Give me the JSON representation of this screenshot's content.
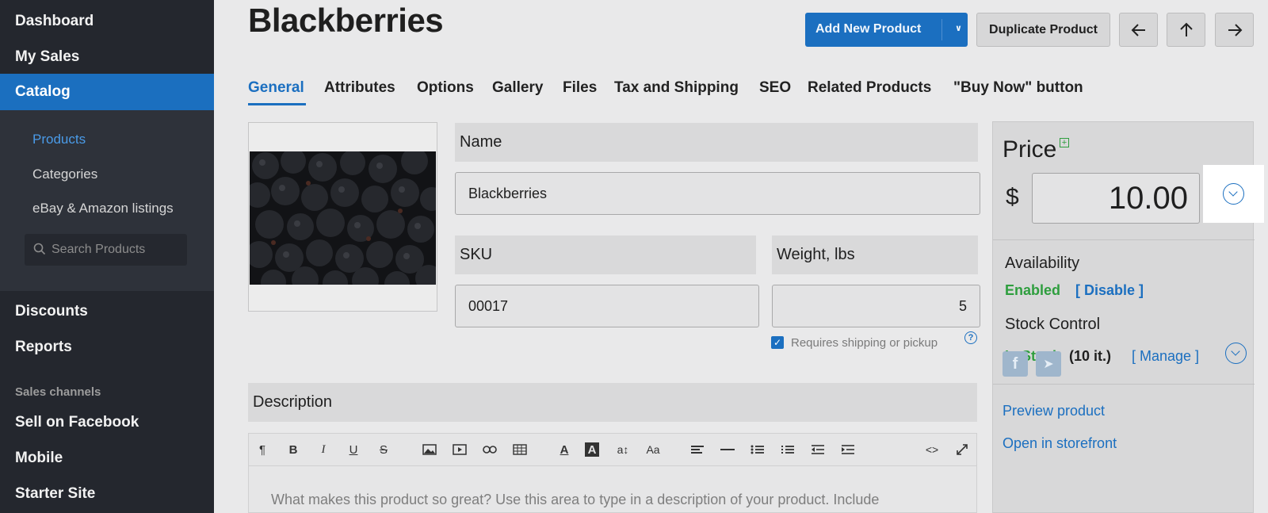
{
  "sidebar": {
    "items_top": [
      "Dashboard",
      "My Sales"
    ],
    "active": "Catalog",
    "submenu": [
      "Products",
      "Categories",
      "eBay & Amazon listings"
    ],
    "search_placeholder": "Search Products",
    "items_bottom": [
      "Discounts",
      "Reports"
    ],
    "section_label": "Sales channels",
    "channels": [
      "Sell on Facebook",
      "Mobile",
      "Starter Site"
    ]
  },
  "header": {
    "title": "Blackberries",
    "add_new": "Add New Product",
    "duplicate": "Duplicate Product"
  },
  "tabs": [
    "General",
    "Attributes",
    "Options",
    "Gallery",
    "Files",
    "Tax and Shipping",
    "SEO",
    "Related Products",
    "\"Buy Now\" button"
  ],
  "form": {
    "name_label": "Name",
    "name_value": "Blackberries",
    "sku_label": "SKU",
    "sku_value": "00017",
    "weight_label": "Weight, lbs",
    "weight_value": "5",
    "requires_shipping": "Requires shipping or pickup",
    "description_label": "Description",
    "description_placeholder": "What makes this product so great? Use this area to type in a description of your product. Include"
  },
  "panel": {
    "price_title": "Price",
    "currency": "$",
    "price_value": "10.00",
    "availability_label": "Availability",
    "availability_status": "Enabled",
    "disable_link": "[ Disable ]",
    "stock_label": "Stock Control",
    "stock_status": "In Stock",
    "stock_count": "(10 it.)",
    "manage_link": "[ Manage ]",
    "preview_link": "Preview product",
    "storefront_link": "Open in storefront"
  },
  "colors": {
    "accent": "#1b6fc0",
    "success": "#2e9e3e",
    "sidebar": "#24272e"
  }
}
